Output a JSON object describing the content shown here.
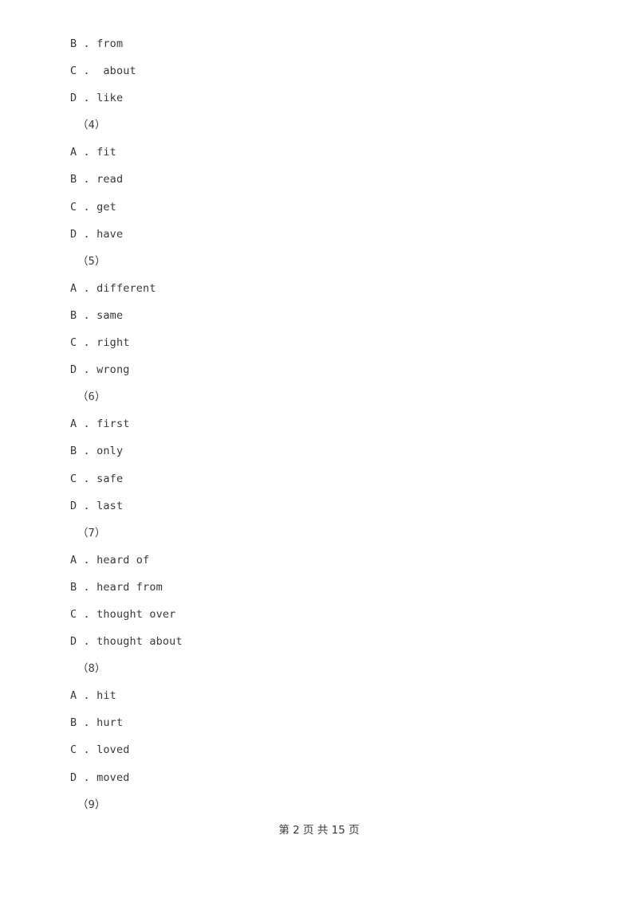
{
  "document": {
    "page_background": "#ffffff",
    "text_color": "#3a3a3a",
    "lines": [
      {
        "id": "line-b-from",
        "kind": "option",
        "text": "B . from"
      },
      {
        "id": "line-c-about",
        "kind": "option",
        "text": "C .  about"
      },
      {
        "id": "line-d-like",
        "kind": "option",
        "text": "D . like"
      },
      {
        "id": "line-q4",
        "kind": "qnum",
        "text": "（4）"
      },
      {
        "id": "line-a-fit",
        "kind": "option",
        "text": "A . fit"
      },
      {
        "id": "line-b-read",
        "kind": "option",
        "text": "B . read"
      },
      {
        "id": "line-c-get",
        "kind": "option",
        "text": "C . get"
      },
      {
        "id": "line-d-have",
        "kind": "option",
        "text": "D . have"
      },
      {
        "id": "line-q5",
        "kind": "qnum",
        "text": "（5）"
      },
      {
        "id": "line-a-different",
        "kind": "option",
        "text": "A . different"
      },
      {
        "id": "line-b-same",
        "kind": "option",
        "text": "B . same"
      },
      {
        "id": "line-c-right",
        "kind": "option",
        "text": "C . right"
      },
      {
        "id": "line-d-wrong",
        "kind": "option",
        "text": "D . wrong"
      },
      {
        "id": "line-q6",
        "kind": "qnum",
        "text": "（6）"
      },
      {
        "id": "line-a-first",
        "kind": "option",
        "text": "A . first"
      },
      {
        "id": "line-b-only",
        "kind": "option",
        "text": "B . only"
      },
      {
        "id": "line-c-safe",
        "kind": "option",
        "text": "C . safe"
      },
      {
        "id": "line-d-last",
        "kind": "option",
        "text": "D . last"
      },
      {
        "id": "line-q7",
        "kind": "qnum",
        "text": "（7）"
      },
      {
        "id": "line-a-heard-of",
        "kind": "option",
        "text": "A . heard of"
      },
      {
        "id": "line-b-heard-from",
        "kind": "option",
        "text": "B . heard from"
      },
      {
        "id": "line-c-thought-over",
        "kind": "option",
        "text": "C . thought over"
      },
      {
        "id": "line-d-thought-about",
        "kind": "option",
        "text": "D . thought about"
      },
      {
        "id": "line-q8",
        "kind": "qnum",
        "text": "（8）"
      },
      {
        "id": "line-a-hit",
        "kind": "option",
        "text": "A . hit"
      },
      {
        "id": "line-b-hurt",
        "kind": "option",
        "text": "B . hurt"
      },
      {
        "id": "line-c-loved",
        "kind": "option",
        "text": "C . loved"
      },
      {
        "id": "line-d-moved",
        "kind": "option",
        "text": "D . moved"
      },
      {
        "id": "line-q9",
        "kind": "qnum",
        "text": "（9）"
      }
    ],
    "footer": {
      "text": "第 2 页 共 15 页",
      "page_number": "2",
      "total_pages": "15"
    }
  }
}
